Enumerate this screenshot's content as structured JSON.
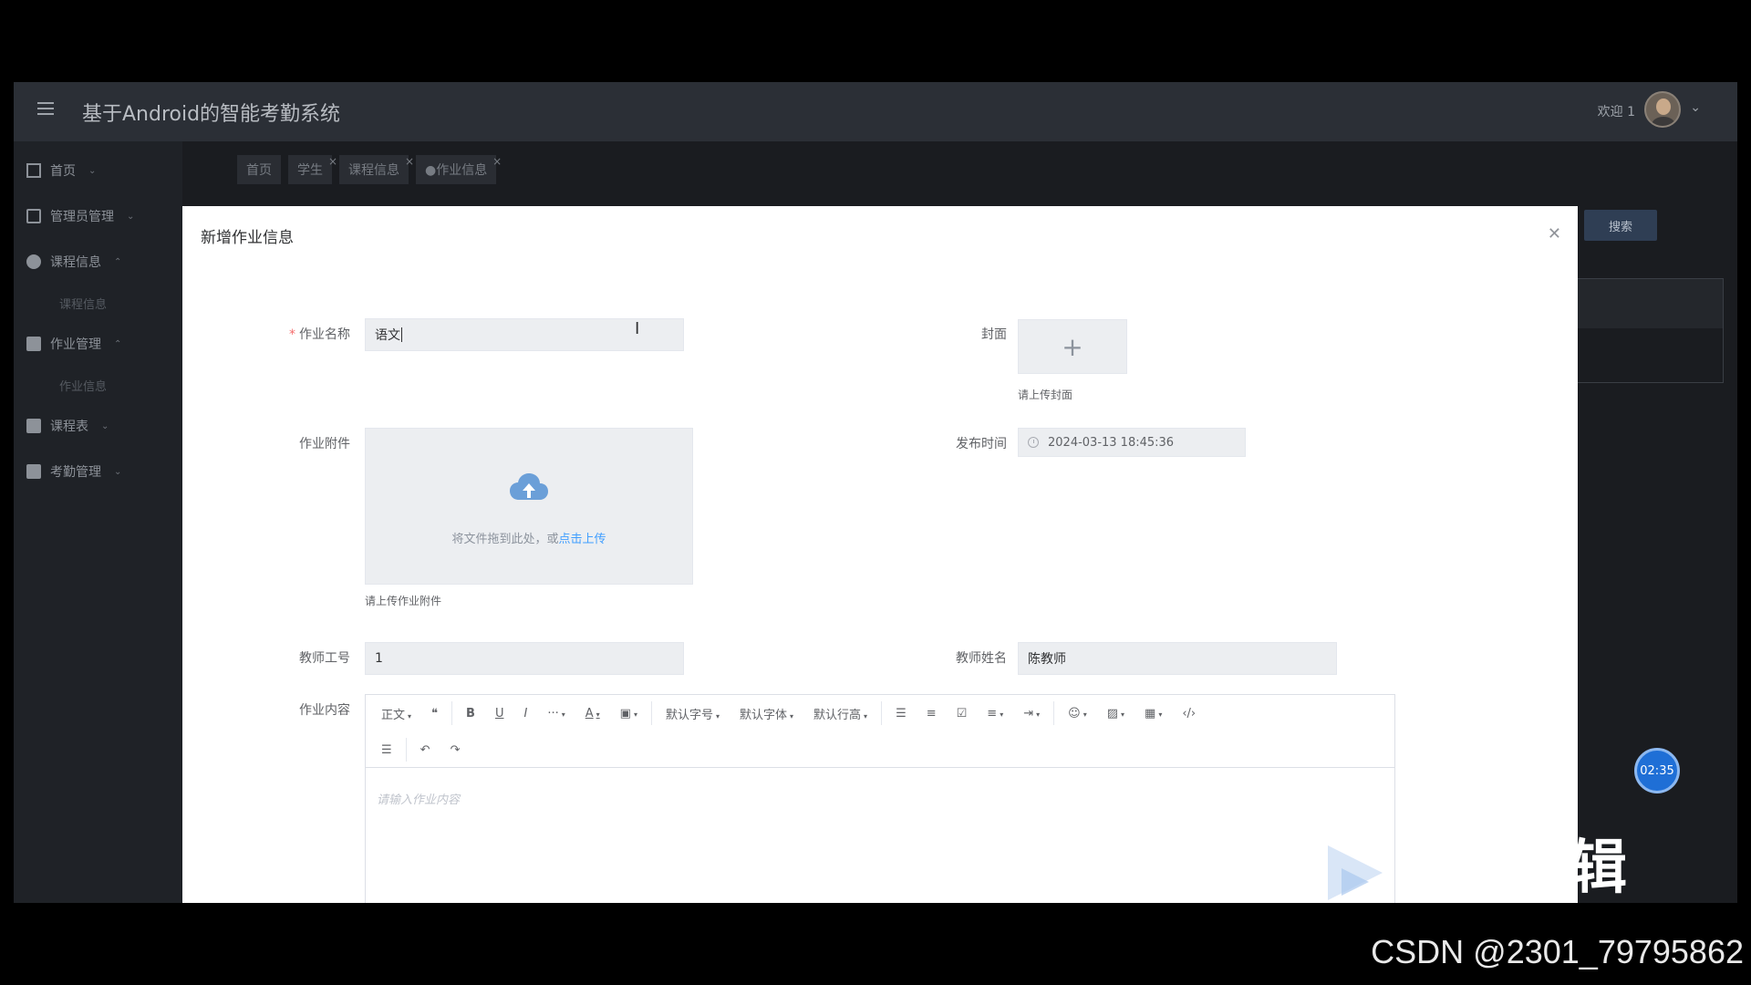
{
  "app": {
    "title": "基于Android的智能考勤系统",
    "welcome": "欢迎 1",
    "sidebar": {
      "items": [
        {
          "label": "首页",
          "icon": "home-icon"
        },
        {
          "label": "管理员管理",
          "icon": "cpu-icon"
        },
        {
          "label": "课程信息",
          "icon": "grid-icon"
        },
        {
          "label": "作业管理",
          "icon": "table-icon"
        },
        {
          "label": "课程表",
          "icon": "apps-icon"
        },
        {
          "label": "考勤管理",
          "icon": "copy-icon"
        }
      ],
      "sub_course": "课程信息",
      "sub_homework": "作业信息"
    },
    "tabs": [
      "首页",
      "学生",
      "课程信息",
      "●作业信息"
    ],
    "search_label": "搜索"
  },
  "modal": {
    "title": "新增作业信息",
    "fields": {
      "name_label": "作业名称",
      "name_value": "语文",
      "cover_label": "封面",
      "cover_hint": "请上传封面",
      "attach_label": "作业附件",
      "upload_text": "将文件拖到此处，或",
      "upload_link": "点击上传",
      "attach_hint": "请上传作业附件",
      "publish_label": "发布时间",
      "publish_value": "2024-03-13 18:45:36",
      "teacher_id_label": "教师工号",
      "teacher_id_value": "1",
      "teacher_name_label": "教师姓名",
      "teacher_name_value": "陈教师",
      "content_label": "作业内容",
      "content_placeholder": "请输入作业内容"
    },
    "toolbar": {
      "paragraph": "正文",
      "font_size": "默认字号",
      "font_family": "默认字体",
      "line_height": "默认行高"
    }
  },
  "overlay": {
    "timer": "02:35",
    "caption_fragment": "辑",
    "watermark": "CSDN @2301_79795862"
  },
  "colors": {
    "primary_link": "#409eff",
    "required": "#f56c6c",
    "timer_bg": "#1f6fd6"
  }
}
